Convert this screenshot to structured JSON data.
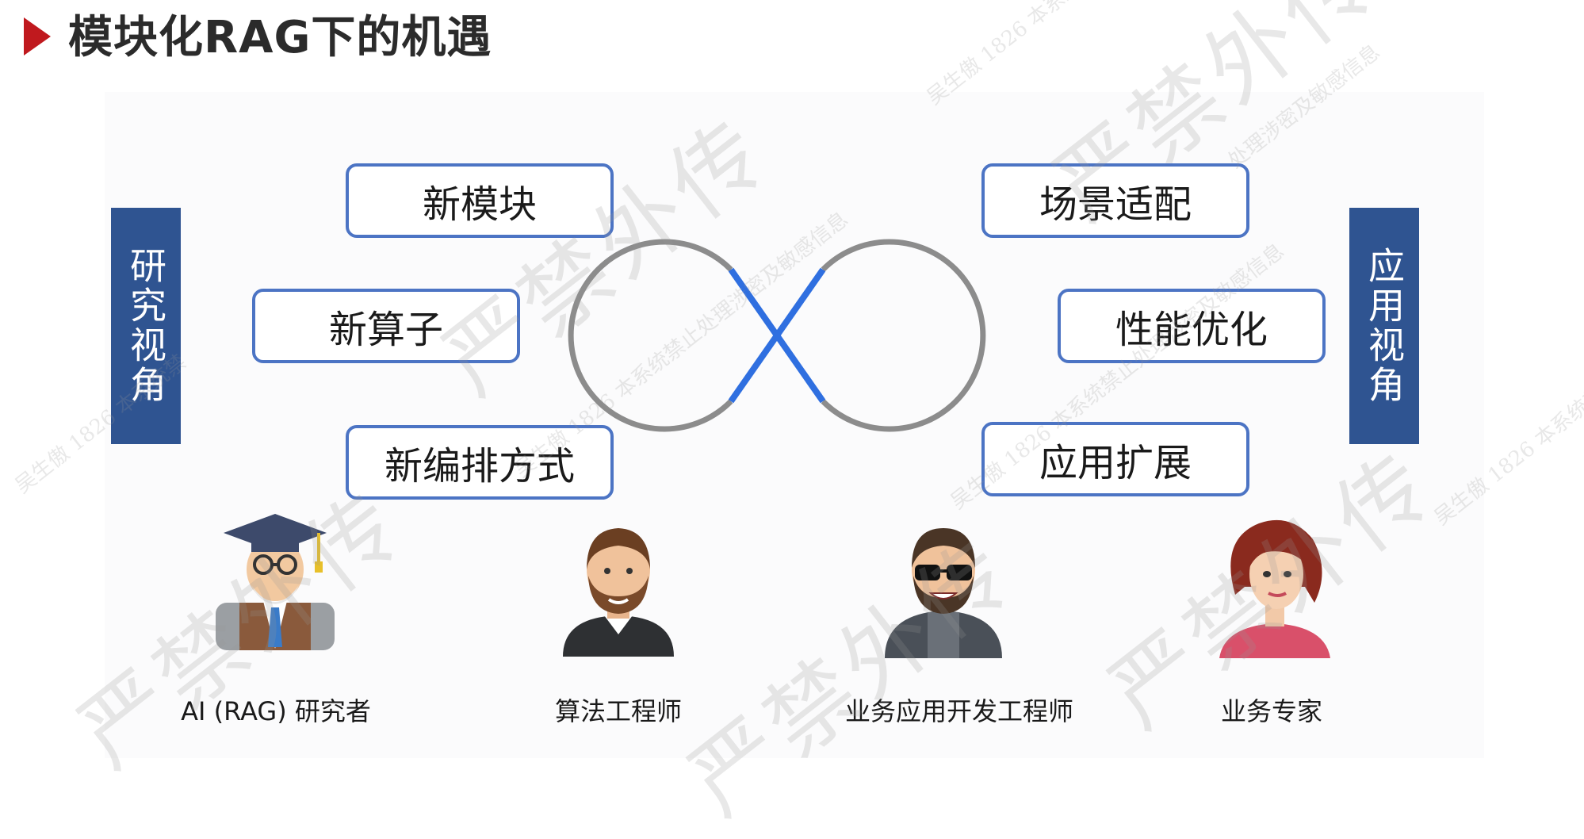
{
  "title": "模块化RAG下的机遇",
  "left_label": "研究视角",
  "right_label": "应用视角",
  "left_items": [
    "新模块",
    "新算子",
    "新编排方式"
  ],
  "right_items": [
    "场景适配",
    "性能优化",
    "应用扩展"
  ],
  "roles": [
    {
      "caption": "AI (RAG) 研究者",
      "icon": "professor-avatar-icon"
    },
    {
      "caption": "算法工程师",
      "icon": "bearded-man-avatar-icon"
    },
    {
      "caption": "业务应用开发工程师",
      "icon": "sunglasses-man-avatar-icon"
    },
    {
      "caption": "业务专家",
      "icon": "woman-avatar-icon"
    }
  ],
  "watermark": {
    "main": "严禁外传",
    "small": [
      "吴生傲 1826 本系统禁止处理涉密及敏感信息",
      "处理涉密及敏感信息",
      "吴生傲 1826 本系统禁"
    ]
  },
  "colors": {
    "accent": "#c0191e",
    "label_bg": "#2f5491",
    "pill_border": "#4c74c4",
    "loop_grey": "#8c8c8c",
    "loop_blue": "#2f6fe0"
  }
}
